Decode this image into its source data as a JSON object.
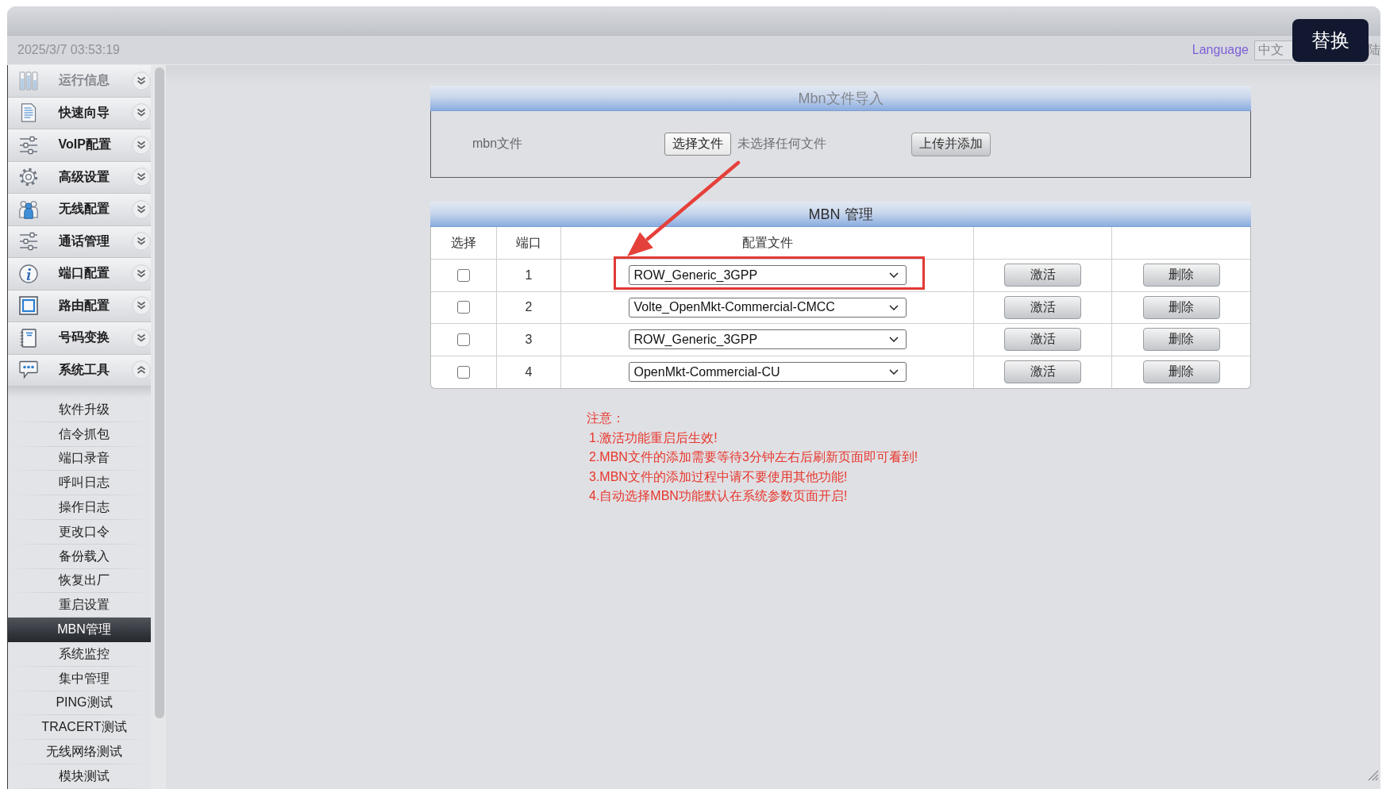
{
  "window": {
    "overlay_button": {
      "label": "替换"
    }
  },
  "status_bar": {
    "datetime": "2025/3/7 03:53:19",
    "language_label": "Language",
    "language_value": "中文",
    "clipped_text": "陆"
  },
  "sidebar": {
    "groups": [
      {
        "label": "运行信息",
        "expanded": false,
        "dimmed": true
      },
      {
        "label": "快速向导",
        "expanded": false,
        "dimmed": false
      },
      {
        "label": "VoIP配置",
        "expanded": false,
        "dimmed": false
      },
      {
        "label": "高级设置",
        "expanded": false,
        "dimmed": false
      },
      {
        "label": "无线配置",
        "expanded": false,
        "dimmed": false
      },
      {
        "label": "通话管理",
        "expanded": false,
        "dimmed": false
      },
      {
        "label": "端口配置",
        "expanded": false,
        "dimmed": false
      },
      {
        "label": "路由配置",
        "expanded": false,
        "dimmed": false
      },
      {
        "label": "号码变换",
        "expanded": false,
        "dimmed": false
      },
      {
        "label": "系统工具",
        "expanded": true,
        "dimmed": false,
        "children": [
          {
            "label": "软件升级",
            "selected": false
          },
          {
            "label": "信令抓包",
            "selected": false
          },
          {
            "label": "端口录音",
            "selected": false
          },
          {
            "label": "呼叫日志",
            "selected": false
          },
          {
            "label": "操作日志",
            "selected": false
          },
          {
            "label": "更改口令",
            "selected": false
          },
          {
            "label": "备份载入",
            "selected": false
          },
          {
            "label": "恢复出厂",
            "selected": false
          },
          {
            "label": "重启设置",
            "selected": false
          },
          {
            "label": "MBN管理",
            "selected": true
          },
          {
            "label": "系统监控",
            "selected": false
          },
          {
            "label": "集中管理",
            "selected": false
          },
          {
            "label": "PING测试",
            "selected": false
          },
          {
            "label": "TRACERT测试",
            "selected": false
          },
          {
            "label": "无线网络测试",
            "selected": false
          },
          {
            "label": "模块测试",
            "selected": false
          }
        ]
      }
    ]
  },
  "upload_panel": {
    "title": "Mbn文件导入",
    "field_label": "mbn文件",
    "file_button": "选择文件",
    "file_status": "未选择任何文件",
    "upload_button": "上传并添加"
  },
  "mbn_panel": {
    "title": "MBN 管理",
    "columns": [
      "选择",
      "端口",
      "配置文件"
    ],
    "rows": [
      {
        "checked": false,
        "port": "1",
        "profile": "ROW_Generic_3GPP",
        "highlighted": true,
        "actions": [
          "激活",
          "删除"
        ]
      },
      {
        "checked": false,
        "port": "2",
        "profile": "Volte_OpenMkt-Commercial-CMCC",
        "highlighted": false,
        "actions": [
          "激活",
          "删除"
        ]
      },
      {
        "checked": false,
        "port": "3",
        "profile": "ROW_Generic_3GPP",
        "highlighted": false,
        "actions": [
          "激活",
          "删除"
        ]
      },
      {
        "checked": false,
        "port": "4",
        "profile": "OpenMkt-Commercial-CU",
        "highlighted": false,
        "actions": [
          "激活",
          "删除"
        ]
      }
    ]
  },
  "notes": {
    "title": "注意：",
    "items": [
      "1.激活功能重启后生效!",
      "2.MBN文件的添加需要等待3分钟左右后刷新页面即可看到!",
      "3.MBN文件的添加过程中请不要使用其他功能!",
      "4.自动选择MBN功能默认在系统参数页面开启!"
    ]
  }
}
